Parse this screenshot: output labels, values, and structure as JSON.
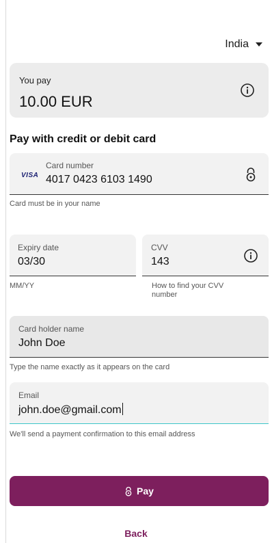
{
  "country": {
    "label": "India",
    "icon": "chevron-down-icon"
  },
  "payment_summary": {
    "label": "You pay",
    "amount": "10.00 EUR",
    "icon": "info-icon"
  },
  "section_title": "Pay with credit or debit card",
  "card_number": {
    "label": "Card number",
    "value": "4017 0423 6103 1490",
    "brand": "VISA",
    "icon": "lock-icon",
    "helper": "Card must be in your name"
  },
  "expiry": {
    "label": "Expiry date",
    "value": "03/30",
    "helper": "MM/YY"
  },
  "cvv": {
    "label": "CVV",
    "value": "143",
    "icon": "info-icon",
    "helper": "How to find your CVV number"
  },
  "card_holder": {
    "label": "Card holder name",
    "value": "John Doe",
    "helper": "Type the name exactly as it appears on the card"
  },
  "email": {
    "label": "Email",
    "value": "john.doe@gmail.com",
    "helper": "We'll send a payment confirmation to this email address"
  },
  "pay_button": {
    "label": "Pay",
    "icon": "lock-icon"
  },
  "back_link": {
    "label": "Back"
  },
  "colors": {
    "primary": "#7d1f5d",
    "focus": "#3bc6c8",
    "field_bg": "#f2f2f2"
  }
}
